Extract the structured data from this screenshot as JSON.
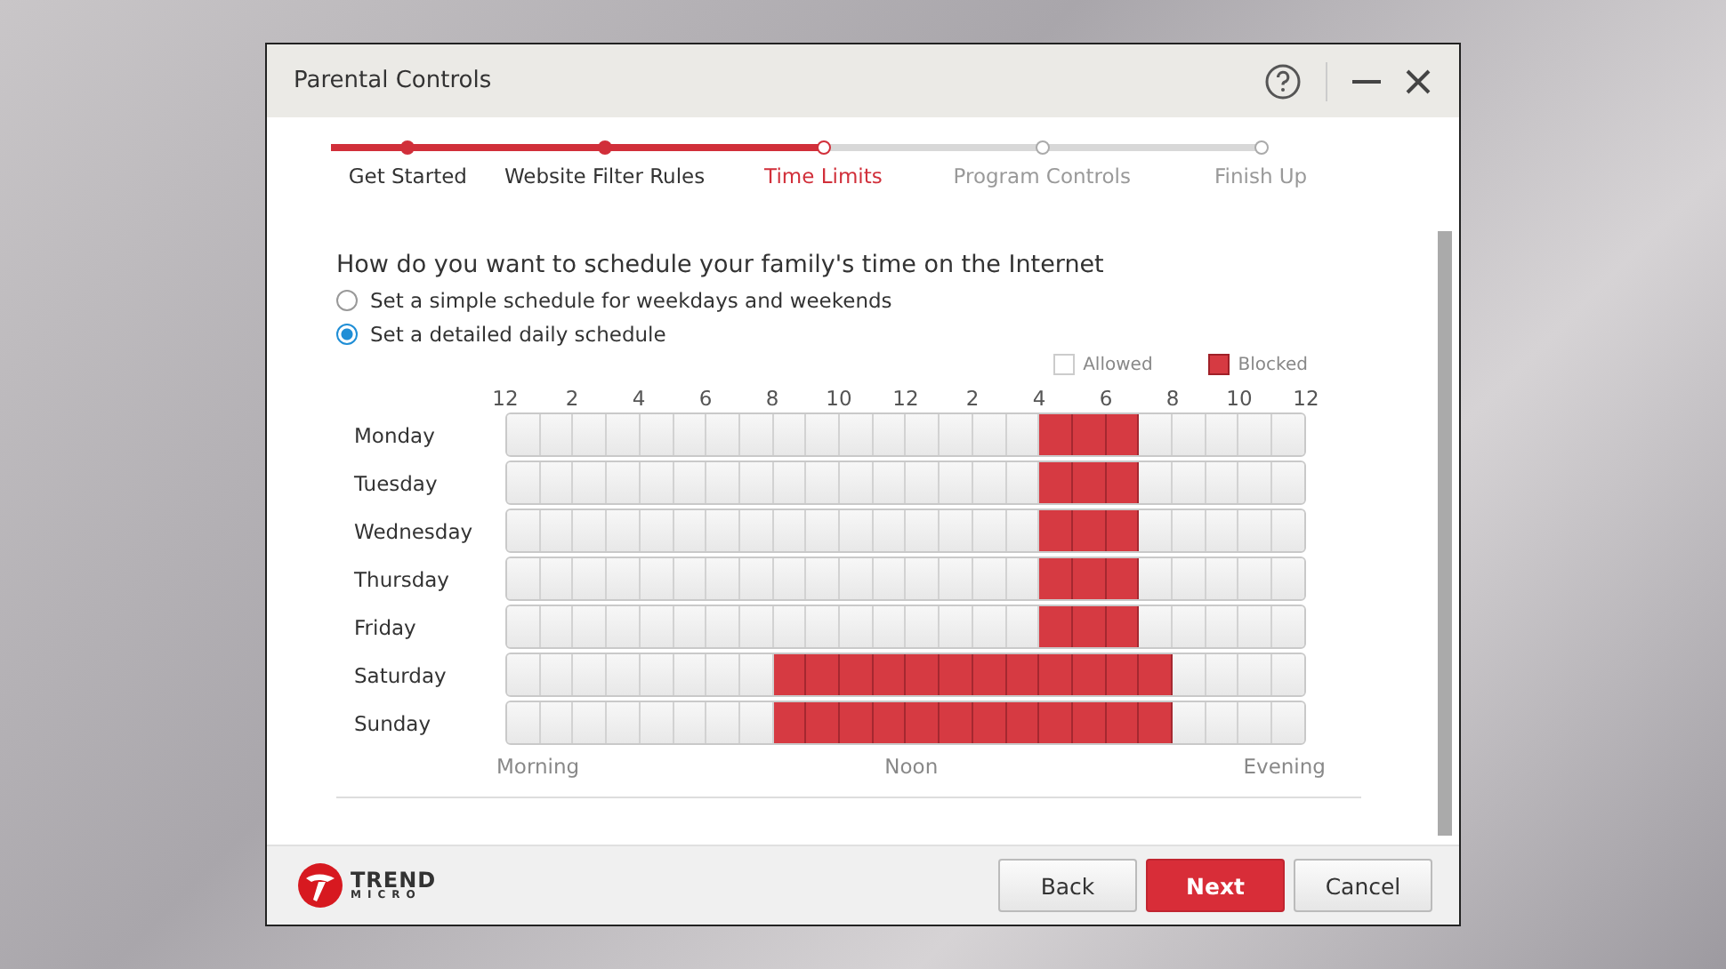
{
  "window": {
    "title": "Parental Controls"
  },
  "steps": [
    {
      "label": "Get Started",
      "done": true,
      "selected": false
    },
    {
      "label": "Website Filter Rules",
      "done": true,
      "selected": false
    },
    {
      "label": "Time Limits",
      "done": false,
      "selected": true
    },
    {
      "label": "Program Controls",
      "done": false,
      "selected": false
    },
    {
      "label": "Finish Up",
      "done": false,
      "selected": false
    }
  ],
  "question": "How do you want to schedule your family's time on the Internet",
  "options": [
    {
      "label": "Set a simple schedule for weekdays and weekends",
      "selected": false
    },
    {
      "label": "Set a detailed daily schedule",
      "selected": true
    }
  ],
  "legend": [
    {
      "label": "Allowed",
      "kind": "allowed"
    },
    {
      "label": "Blocked",
      "kind": "blocked"
    }
  ],
  "hour_labels": [
    "12",
    "2",
    "4",
    "6",
    "8",
    "10",
    "12",
    "2",
    "4",
    "6",
    "8",
    "10",
    "12"
  ],
  "days": [
    {
      "name": "Monday",
      "blocked": [
        false,
        false,
        false,
        false,
        false,
        false,
        false,
        false,
        false,
        false,
        false,
        false,
        false,
        false,
        false,
        false,
        true,
        true,
        true,
        false,
        false,
        false,
        false,
        false
      ]
    },
    {
      "name": "Tuesday",
      "blocked": [
        false,
        false,
        false,
        false,
        false,
        false,
        false,
        false,
        false,
        false,
        false,
        false,
        false,
        false,
        false,
        false,
        true,
        true,
        true,
        false,
        false,
        false,
        false,
        false
      ]
    },
    {
      "name": "Wednesday",
      "blocked": [
        false,
        false,
        false,
        false,
        false,
        false,
        false,
        false,
        false,
        false,
        false,
        false,
        false,
        false,
        false,
        false,
        true,
        true,
        true,
        false,
        false,
        false,
        false,
        false
      ]
    },
    {
      "name": "Thursday",
      "blocked": [
        false,
        false,
        false,
        false,
        false,
        false,
        false,
        false,
        false,
        false,
        false,
        false,
        false,
        false,
        false,
        false,
        true,
        true,
        true,
        false,
        false,
        false,
        false,
        false
      ]
    },
    {
      "name": "Friday",
      "blocked": [
        false,
        false,
        false,
        false,
        false,
        false,
        false,
        false,
        false,
        false,
        false,
        false,
        false,
        false,
        false,
        false,
        true,
        true,
        true,
        false,
        false,
        false,
        false,
        false
      ]
    },
    {
      "name": "Saturday",
      "blocked": [
        false,
        false,
        false,
        false,
        false,
        false,
        false,
        false,
        true,
        true,
        true,
        true,
        true,
        true,
        true,
        true,
        true,
        true,
        true,
        true,
        false,
        false,
        false,
        false
      ]
    },
    {
      "name": "Sunday",
      "blocked": [
        false,
        false,
        false,
        false,
        false,
        false,
        false,
        false,
        true,
        true,
        true,
        true,
        true,
        true,
        true,
        true,
        true,
        true,
        true,
        true,
        false,
        false,
        false,
        false
      ]
    }
  ],
  "period_labels": [
    "Morning",
    "Noon",
    "Evening"
  ],
  "logo": {
    "line1": "TREND",
    "line2": "MICRO"
  },
  "buttons": [
    {
      "label": "Back",
      "kind": "secondary"
    },
    {
      "label": "Next",
      "kind": "primary"
    },
    {
      "label": "Cancel",
      "kind": "secondary"
    }
  ]
}
